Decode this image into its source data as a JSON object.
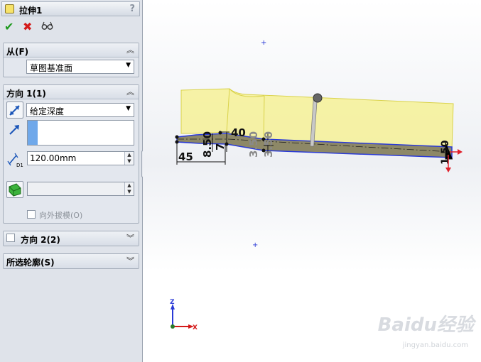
{
  "feature": {
    "title": "拉伸1",
    "help": "?"
  },
  "actions": {
    "ok": "✔",
    "cancel": "✖",
    "preview": "👓"
  },
  "from_group": {
    "title": "从(F)",
    "value": "草图基准面"
  },
  "dir1_group": {
    "title": "方向 1(1)",
    "end_condition": "给定深度",
    "depth": "120.00mm",
    "depth_icon_label": "D1",
    "draft_value": "",
    "draft_outward": "向外拔模(O)"
  },
  "dir2_group": {
    "title": "方向 2(2)"
  },
  "contours_group": {
    "title": "所选轮廓(S)"
  },
  "dimensions": {
    "d40": "40",
    "d850": "8.50",
    "d7": "7",
    "d45": "45",
    "d3a": "3.50",
    "d3b": "3.50",
    "d_end": "1.50"
  },
  "triad": {
    "z": "Z",
    "x": "X"
  },
  "watermark": {
    "brand": "Baidu经验",
    "url": "jingyan.baidu.com"
  },
  "colors": {
    "extrude_preview": "#f5f08a",
    "sketch": "#2a3ad6",
    "arrow": "#e0202a"
  }
}
